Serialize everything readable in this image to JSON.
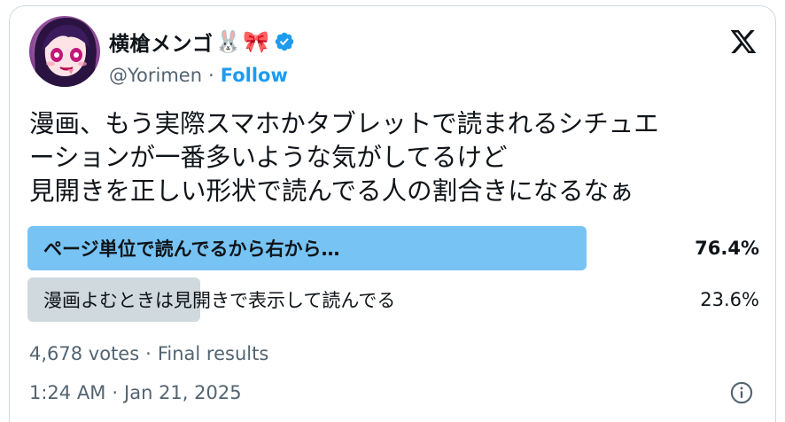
{
  "author": {
    "display_name": "横槍メンゴ",
    "name_emojis": [
      "🐰",
      "🎀"
    ],
    "handle": "@Yorimen",
    "separator": "·",
    "follow_label": "Follow",
    "verified_icon": "verified-badge-icon",
    "avatar_icon": "avatar"
  },
  "brand": {
    "logo_icon": "x-logo-icon"
  },
  "tweet": {
    "text": "漫画、もう実際スマホかタブレットで読まれるシチュエ\nーションが一番多いような気がしてるけど\n見開きを正しい形状で読んでる人の割合きになるなぁ"
  },
  "poll": {
    "options": [
      {
        "label": "ページ単位で読んでるから右から…",
        "percent_label": "76.4%",
        "percent": 76.4,
        "winner": true
      },
      {
        "label": "漫画よむときは見開きで表示して読んでる",
        "percent_label": "23.6%",
        "percent": 23.6,
        "winner": false
      }
    ],
    "votes": "4,678 votes",
    "separator": "·",
    "status": "Final results"
  },
  "meta": {
    "time": "1:24 AM",
    "separator": "·",
    "date": "Jan 21, 2025",
    "info_icon": "info-icon"
  },
  "colors": {
    "accent": "#1d9bf0",
    "winner_bar": "#77c3f4",
    "loser_bar": "#cfd9de",
    "text": "#0f1419",
    "muted": "#536471"
  }
}
